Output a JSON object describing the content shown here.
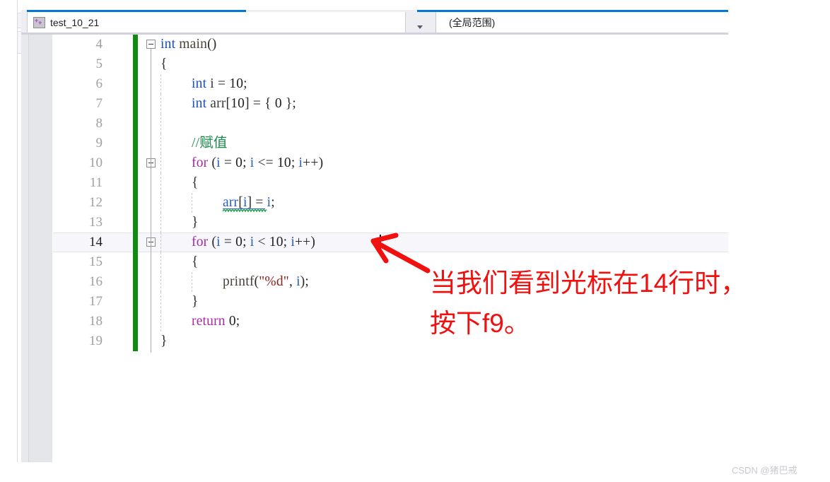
{
  "window": {
    "accent_color": "#0078d7",
    "tab": {
      "label": "test_10_21",
      "icon": "cpp-file-icon"
    },
    "scope_selector": {
      "value": "(全局范围)"
    }
  },
  "editor": {
    "change_bar_color": "#108a10",
    "current_line": 14,
    "lines": [
      {
        "no": "4",
        "indent": 0,
        "text": "int main()",
        "fold": "open"
      },
      {
        "no": "5",
        "indent": 0,
        "text": "{",
        "fold": "none"
      },
      {
        "no": "6",
        "indent": 1,
        "text": "int i = 10;",
        "fold": "none"
      },
      {
        "no": "7",
        "indent": 1,
        "text": "int arr[10] = { 0 };",
        "fold": "none"
      },
      {
        "no": "8",
        "indent": 1,
        "text": "",
        "fold": "none"
      },
      {
        "no": "9",
        "indent": 1,
        "text": "//赋值",
        "fold": "none"
      },
      {
        "no": "10",
        "indent": 1,
        "text": "for (i = 0; i <= 10; i++)",
        "fold": "open"
      },
      {
        "no": "11",
        "indent": 1,
        "text": "{",
        "fold": "none"
      },
      {
        "no": "12",
        "indent": 2,
        "text": "arr[i] = i;",
        "fold": "none"
      },
      {
        "no": "13",
        "indent": 1,
        "text": "}",
        "fold": "none"
      },
      {
        "no": "14",
        "indent": 1,
        "text": "for (i = 0; i < 10; i++)",
        "fold": "open"
      },
      {
        "no": "15",
        "indent": 1,
        "text": "{",
        "fold": "none"
      },
      {
        "no": "16",
        "indent": 2,
        "text": "printf(\"%d\", i);",
        "fold": "none"
      },
      {
        "no": "17",
        "indent": 1,
        "text": "}",
        "fold": "none"
      },
      {
        "no": "18",
        "indent": 1,
        "text": "return 0;",
        "fold": "none"
      },
      {
        "no": "19",
        "indent": 0,
        "text": "}",
        "fold": "none"
      }
    ],
    "tokens": {
      "l4": [
        [
          "int",
          "kw-type"
        ],
        [
          " ",
          "punct"
        ],
        [
          "main",
          "fn"
        ],
        [
          "()",
          "punct"
        ]
      ],
      "l5": [
        [
          "{",
          "punct"
        ]
      ],
      "l6": [
        [
          "int",
          "kw-type"
        ],
        [
          " ",
          "punct"
        ],
        [
          "i",
          "ident"
        ],
        [
          " = ",
          "punct"
        ],
        [
          "10",
          "num"
        ],
        [
          ";",
          "punct"
        ]
      ],
      "l7": [
        [
          "int",
          "kw-type"
        ],
        [
          " ",
          "punct"
        ],
        [
          "arr",
          "ident"
        ],
        [
          "[",
          "punct"
        ],
        [
          "10",
          "num"
        ],
        [
          "] = { ",
          "punct"
        ],
        [
          "0",
          "num"
        ],
        [
          " };",
          "punct"
        ]
      ],
      "l9": [
        [
          "//赋值",
          "cmt"
        ]
      ],
      "l10": [
        [
          "for",
          "kw-ctrl"
        ],
        [
          " (",
          "punct"
        ],
        [
          "i",
          "var-blue"
        ],
        [
          " = ",
          "punct"
        ],
        [
          "0",
          "num"
        ],
        [
          "; ",
          "punct"
        ],
        [
          "i",
          "var-blue"
        ],
        [
          " <= ",
          "punct"
        ],
        [
          "10",
          "num"
        ],
        [
          "; ",
          "punct"
        ],
        [
          "i",
          "var-blue"
        ],
        [
          "++)",
          "punct"
        ]
      ],
      "l11": [
        [
          "{",
          "punct"
        ]
      ],
      "l12": [
        [
          "arr",
          "var-blue"
        ],
        [
          "[",
          "punct"
        ],
        [
          "i",
          "var-blue"
        ],
        [
          "]",
          "punct"
        ],
        [
          " = ",
          "punct"
        ],
        [
          "i",
          "var-blue"
        ],
        [
          ";",
          "punct"
        ]
      ],
      "l13": [
        [
          "}",
          "punct"
        ]
      ],
      "l14": [
        [
          "for",
          "kw-ctrl"
        ],
        [
          " (",
          "punct"
        ],
        [
          "i",
          "var-blue"
        ],
        [
          " = ",
          "punct"
        ],
        [
          "0",
          "num"
        ],
        [
          "; ",
          "punct"
        ],
        [
          "i",
          "var-blue"
        ],
        [
          " < ",
          "punct"
        ],
        [
          "10",
          "num"
        ],
        [
          "; ",
          "punct"
        ],
        [
          "i",
          "var-blue"
        ],
        [
          "++)",
          "punct"
        ]
      ],
      "l15": [
        [
          "{",
          "punct"
        ]
      ],
      "l16": [
        [
          "printf",
          "fn"
        ],
        [
          "(",
          "punct"
        ],
        [
          "\"%d\"",
          "str"
        ],
        [
          ", ",
          "punct"
        ],
        [
          "i",
          "var-blue"
        ],
        [
          ");",
          "punct"
        ]
      ],
      "l17": [
        [
          "}",
          "punct"
        ]
      ],
      "l18": [
        [
          "return",
          "kw-ctrl"
        ],
        [
          " ",
          "punct"
        ],
        [
          "0",
          "num"
        ],
        [
          ";",
          "punct"
        ]
      ],
      "l19": [
        [
          "}",
          "punct"
        ]
      ]
    }
  },
  "annotation": {
    "color": "#f01010",
    "text": "当我们看到光标在14行时，\n按下f9。",
    "arrow": "red-arrow-to-caret"
  },
  "watermark": {
    "text": "CSDN @猪巴戒"
  }
}
